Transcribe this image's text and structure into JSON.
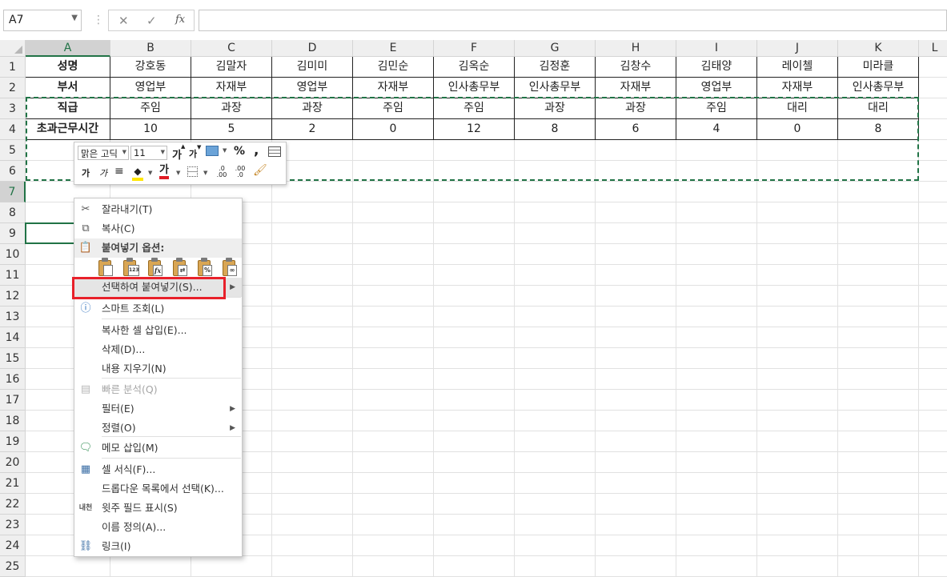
{
  "formula_bar": {
    "name_box": "A7",
    "cancel_glyph": "✕",
    "enter_glyph": "✓",
    "fx_label": "fx",
    "formula_value": ""
  },
  "grid": {
    "columns": [
      "A",
      "B",
      "C",
      "D",
      "E",
      "F",
      "G",
      "H",
      "I",
      "J",
      "K",
      "L"
    ],
    "rows": [
      "1",
      "2",
      "3",
      "4",
      "5",
      "6",
      "7",
      "8",
      "9",
      "10",
      "11",
      "12",
      "13",
      "14",
      "15",
      "16",
      "17",
      "18",
      "19",
      "20",
      "21",
      "22",
      "23",
      "24",
      "25"
    ],
    "selected_column": "A",
    "selected_row": "7",
    "table": [
      [
        "성명",
        "강호동",
        "김말자",
        "김미미",
        "김민순",
        "김옥순",
        "김정훈",
        "김창수",
        "김태양",
        "레이첼",
        "미라클"
      ],
      [
        "부서",
        "영업부",
        "자재부",
        "영업부",
        "자재부",
        "인사총무부",
        "인사총무부",
        "자재부",
        "영업부",
        "자재부",
        "인사총무부"
      ],
      [
        "직급",
        "주임",
        "과장",
        "과장",
        "주임",
        "주임",
        "과장",
        "과장",
        "주임",
        "대리",
        "대리"
      ],
      [
        "초과근무시간",
        "10",
        "5",
        "2",
        "0",
        "12",
        "8",
        "6",
        "4",
        "0",
        "8"
      ]
    ]
  },
  "mini_toolbar": {
    "font_name": "맑은 고딕",
    "font_size": "11",
    "grow_font": "가",
    "shrink_font": "가",
    "percent": "%",
    "comma": ",",
    "bold": "가",
    "italic": "가",
    "font_color": "가",
    "increase_decimal": ".0 .00",
    "decrease_decimal": ".00 .0"
  },
  "context_menu": {
    "items": [
      {
        "label": "잘라내기(T)",
        "icon": "scissors-icon",
        "enabled": true
      },
      {
        "label": "복사(C)",
        "icon": "copy-icon",
        "enabled": true
      },
      {
        "label": "붙여넣기 옵션:",
        "icon": "paste-icon",
        "section": true
      },
      {
        "label": "선택하여 붙여넣기(S)...",
        "submenu": true,
        "highlight": true
      },
      {
        "label": "스마트 조회(L)",
        "icon": "smart-lookup-icon",
        "enabled": true
      },
      {
        "label": "복사한 셀 삽입(E)...",
        "enabled": true
      },
      {
        "label": "삭제(D)...",
        "enabled": true
      },
      {
        "label": "내용 지우기(N)",
        "enabled": true
      },
      {
        "label": "빠른 분석(Q)",
        "icon": "quick-analysis-icon",
        "enabled": false
      },
      {
        "label": "필터(E)",
        "submenu": true,
        "enabled": true
      },
      {
        "label": "정렬(O)",
        "submenu": true,
        "enabled": true
      },
      {
        "label": "메모 삽입(M)",
        "icon": "comment-icon",
        "enabled": true
      },
      {
        "label": "셀 서식(F)...",
        "icon": "format-cells-icon",
        "enabled": true
      },
      {
        "label": "드롭다운 목록에서 선택(K)...",
        "enabled": true
      },
      {
        "label": "윗주 필드 표시(S)",
        "icon": "phonetic-icon",
        "enabled": true
      },
      {
        "label": "이름 정의(A)...",
        "enabled": true
      },
      {
        "label": "링크(I)",
        "icon": "link-icon",
        "enabled": true
      }
    ],
    "paste_options": [
      "paste-icon",
      "paste-values-icon",
      "paste-formulas-icon",
      "paste-transpose-icon",
      "paste-formatting-icon",
      "paste-link-icon"
    ],
    "paste_option_glyphs": [
      "",
      "123",
      "fx",
      "⇄",
      "%",
      "∞"
    ],
    "phonetic_glyph": "내천"
  }
}
